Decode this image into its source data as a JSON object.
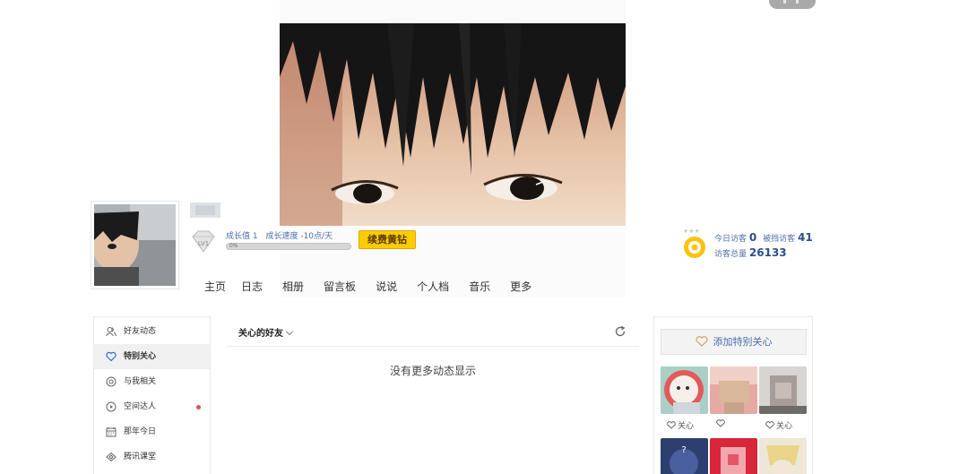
{
  "profile": {
    "growth_value_label": "成长值 1",
    "growth_speed_label": "成长速度 -10点/天",
    "growth_percent": "0%",
    "level_badge": "LV1",
    "renew_button": "续费黄钻"
  },
  "nav": {
    "tabs": [
      "主页",
      "日志",
      "相册",
      "留言板",
      "说说",
      "个人档",
      "音乐",
      "更多"
    ]
  },
  "visitors": {
    "today_label": "今日访客",
    "today_value": "0",
    "blocked_label": "被挡访客",
    "blocked_value": "41",
    "total_label": "访客总量",
    "total_value": "26133"
  },
  "sidebar": {
    "items": [
      {
        "label": "好友动态",
        "icon": "friends-icon"
      },
      {
        "label": "特别关心",
        "icon": "heart-icon"
      },
      {
        "label": "与我相关",
        "icon": "at-icon"
      },
      {
        "label": "空间达人",
        "icon": "play-icon"
      },
      {
        "label": "那年今日",
        "icon": "calendar-icon"
      },
      {
        "label": "腾讯课堂",
        "icon": "classroom-icon"
      }
    ]
  },
  "feed": {
    "filter_label": "关心的好友",
    "empty_text": "没有更多动态显示"
  },
  "special_care": {
    "add_label": "添加特别关心",
    "follow_label": "关心"
  },
  "colors": {
    "accent_blue": "#4a6ea8",
    "renew_yellow": "#ffcc00",
    "notify_red": "#d9534f"
  }
}
